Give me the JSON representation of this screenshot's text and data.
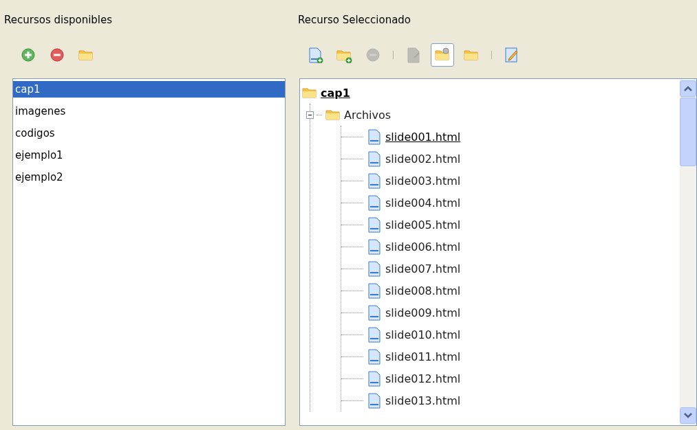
{
  "left": {
    "title": "Recursos disponibles",
    "toolbar": [
      {
        "kind": "add"
      },
      {
        "kind": "remove"
      },
      {
        "kind": "folder"
      }
    ],
    "items": [
      {
        "label": "cap1",
        "selected": true
      },
      {
        "label": "imagenes",
        "selected": false
      },
      {
        "label": "codigos",
        "selected": false
      },
      {
        "label": "ejemplo1",
        "selected": false
      },
      {
        "label": "ejemplo2",
        "selected": false
      }
    ]
  },
  "right": {
    "title": "Recurso Seleccionado",
    "toolbar": [
      {
        "kind": "new-file",
        "disabled": false,
        "pressed": false
      },
      {
        "kind": "new-folder",
        "disabled": false,
        "pressed": false
      },
      {
        "kind": "remove",
        "disabled": true,
        "pressed": false
      },
      {
        "kind": "separator"
      },
      {
        "kind": "file-edit",
        "disabled": true,
        "pressed": false
      },
      {
        "kind": "folder-settings",
        "disabled": false,
        "pressed": true
      },
      {
        "kind": "folder",
        "disabled": false,
        "pressed": false
      },
      {
        "kind": "separator"
      },
      {
        "kind": "edit",
        "disabled": false,
        "pressed": false
      }
    ],
    "tree": {
      "label": "cap1",
      "children": [
        {
          "label": "Archivos",
          "expanded": true,
          "children": [
            {
              "label": "slide001.html",
              "selected": true
            },
            {
              "label": "slide002.html",
              "selected": false
            },
            {
              "label": "slide003.html",
              "selected": false
            },
            {
              "label": "slide004.html",
              "selected": false
            },
            {
              "label": "slide005.html",
              "selected": false
            },
            {
              "label": "slide006.html",
              "selected": false
            },
            {
              "label": "slide007.html",
              "selected": false
            },
            {
              "label": "slide008.html",
              "selected": false
            },
            {
              "label": "slide009.html",
              "selected": false
            },
            {
              "label": "slide010.html",
              "selected": false
            },
            {
              "label": "slide011.html",
              "selected": false
            },
            {
              "label": "slide012.html",
              "selected": false
            },
            {
              "label": "slide013.html",
              "selected": false
            }
          ]
        }
      ]
    }
  }
}
